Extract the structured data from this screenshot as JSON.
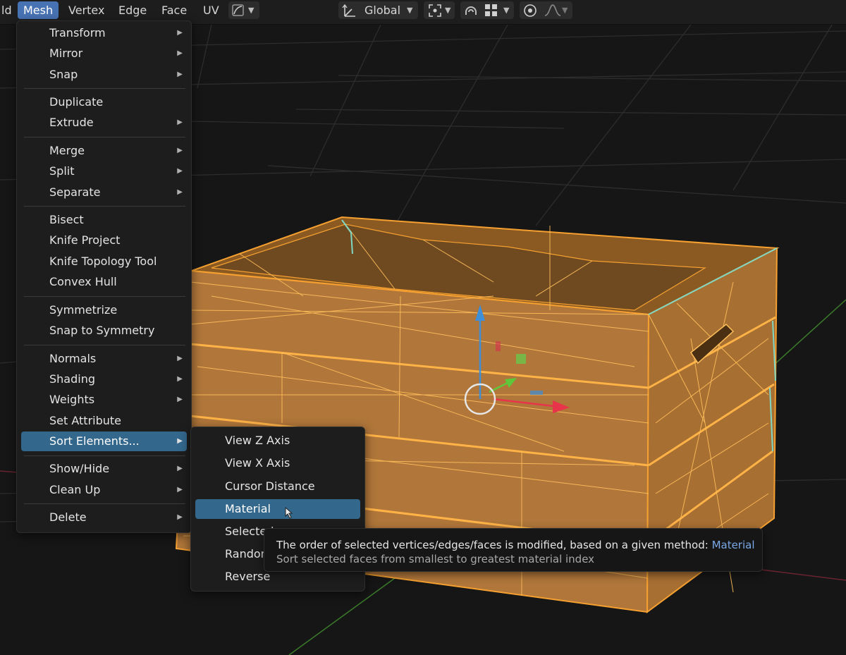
{
  "header": {
    "left_cut_label": "ld",
    "menus": [
      "Mesh",
      "Vertex",
      "Edge",
      "Face",
      "UV"
    ],
    "active_menu": "Mesh",
    "transform_orientation": "Global"
  },
  "mesh_menu": {
    "items": [
      {
        "label": "Transform",
        "submenu": true
      },
      {
        "label": "Mirror",
        "submenu": true
      },
      {
        "label": "Snap",
        "submenu": true
      },
      {
        "label": "Duplicate",
        "submenu": false
      },
      {
        "label": "Extrude",
        "submenu": true
      },
      {
        "label": "Merge",
        "submenu": true
      },
      {
        "label": "Split",
        "submenu": true
      },
      {
        "label": "Separate",
        "submenu": true
      },
      {
        "label": "Bisect",
        "submenu": false
      },
      {
        "label": "Knife Project",
        "submenu": false
      },
      {
        "label": "Knife Topology Tool",
        "submenu": false
      },
      {
        "label": "Convex Hull",
        "submenu": false
      },
      {
        "label": "Symmetrize",
        "submenu": false
      },
      {
        "label": "Snap to Symmetry",
        "submenu": false
      },
      {
        "label": "Normals",
        "submenu": true
      },
      {
        "label": "Shading",
        "submenu": true
      },
      {
        "label": "Weights",
        "submenu": true
      },
      {
        "label": "Set Attribute",
        "submenu": false
      },
      {
        "label": "Sort Elements...",
        "submenu": true,
        "highlighted": true
      },
      {
        "label": "Show/Hide",
        "submenu": true
      },
      {
        "label": "Clean Up",
        "submenu": true
      },
      {
        "label": "Delete",
        "submenu": true
      }
    ]
  },
  "sort_submenu": {
    "items": [
      {
        "label": "View Z Axis"
      },
      {
        "label": "View X Axis"
      },
      {
        "label": "Cursor Distance"
      },
      {
        "label": "Material",
        "highlighted": true
      },
      {
        "label": "Selected"
      },
      {
        "label": "Randomize"
      },
      {
        "label": "Reverse"
      }
    ]
  },
  "tooltip": {
    "line1": "The order of selected vertices/edges/faces is modified, based on a given method: ",
    "line1_highlight": "Material",
    "line2": "Sort selected faces from smallest to greatest material index"
  },
  "colors": {
    "accent": "#4772b3",
    "menu_highlight": "#33678c",
    "mesh_orange": "#f5a030",
    "x_axis": "#e8344a",
    "y_axis": "#5fc83a",
    "z_axis": "#3d8fd8"
  },
  "icons": [
    "transform-pivot-icon",
    "snap-target-icon",
    "snap-magnet-icon",
    "snap-grid-icon",
    "proportional-edit-icon",
    "falloff-curve-icon",
    "mouse-cursor-icon"
  ]
}
